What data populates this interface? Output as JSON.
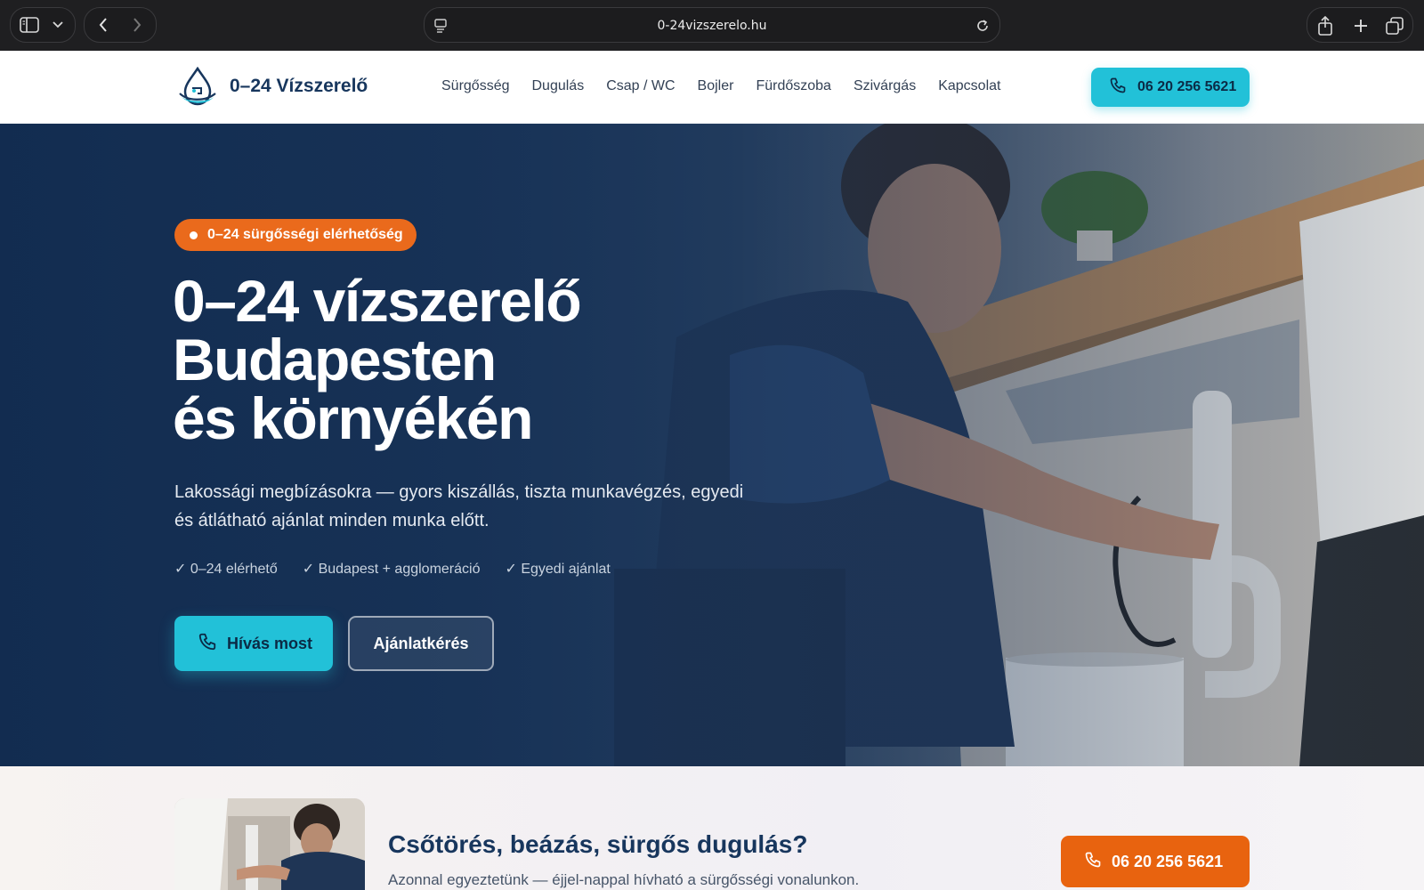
{
  "browser": {
    "url": "0-24vizszerelo.hu",
    "icons": [
      "sidebar-icon",
      "chevron-down-icon",
      "back-icon",
      "forward-icon",
      "page-icon",
      "reload-icon",
      "share-icon",
      "new-tab-icon",
      "tabs-icon"
    ]
  },
  "nav": {
    "brand": "0–24 Vízszerelő",
    "menu": [
      "Sürgősség",
      "Dugulás",
      "Csap / WC",
      "Bojler",
      "Fürdőszoba",
      "Szivárgás",
      "Kapcsolat"
    ],
    "call_label": "06 20 256 5621"
  },
  "hero": {
    "badge": "0–24 sürgősségi elérhetőség",
    "headline": [
      "0–24 vízszerelő",
      "Budapesten",
      "és környékén"
    ],
    "subtitle": "Lakossági megbízásokra — gyors kiszállás, tiszta munkavégzés, egyedi és átlátható ajánlat minden munka előtt.",
    "checks": [
      "✓ 0–24 elérhető",
      "✓ Budapest + agglomeráció",
      "✓ Egyedi ajánlat"
    ],
    "primary_button": "Hívás most",
    "secondary_button": "Ajánlatkérés"
  },
  "emergency": {
    "title": "Csőtörés, beázás, sürgős dugulás?",
    "subtitle": "Azonnal egyeztetünk — éjjel-nappal hívható a sürgősségi vonalunkon.",
    "call_label": "06 20 256 5621"
  },
  "colors": {
    "accent": "#22c1d8",
    "orange": "#e8630f",
    "navy": "#17365d"
  }
}
